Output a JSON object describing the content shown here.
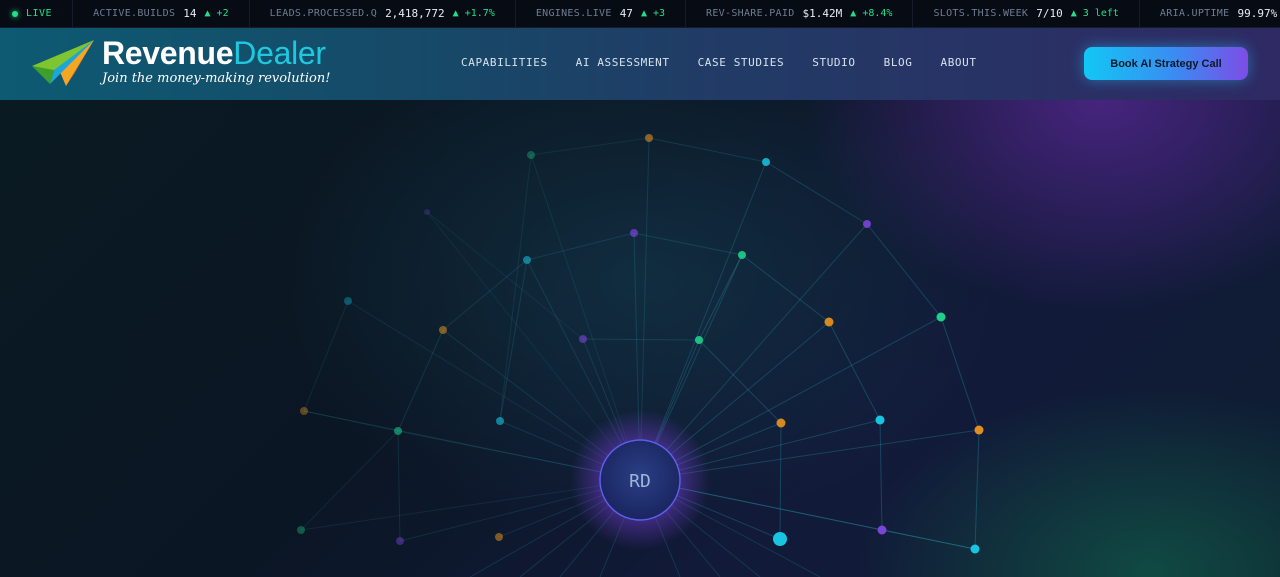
{
  "ticker": {
    "live_label": "LIVE",
    "items": [
      {
        "label": "ACTIVE.BUILDS",
        "value": "14",
        "delta": "▲ +2"
      },
      {
        "label": "LEADS.PROCESSED.Q",
        "value": "2,418,772",
        "delta": "▲ +1.7%"
      },
      {
        "label": "ENGINES.LIVE",
        "value": "47",
        "delta": "▲ +3"
      },
      {
        "label": "REV-SHARE.PAID",
        "value": "$1.42M",
        "delta": "▲ +8.4%"
      },
      {
        "label": "SLOTS.THIS.WEEK",
        "value": "7/10",
        "delta": "▲ 3 left"
      },
      {
        "label": "ARIA.UPTIME",
        "value": "99.97%",
        "delta": ""
      }
    ]
  },
  "brand": {
    "name_a": "Revenue",
    "name_b": "Dealer",
    "tagline": "Join the money-making revolution!"
  },
  "nav": {
    "items": [
      "CAPABILITIES",
      "AI ASSESSMENT",
      "CASE STUDIES",
      "STUDIO",
      "BLOG",
      "ABOUT"
    ]
  },
  "cta": {
    "label": "Book AI Strategy Call"
  },
  "hero": {
    "core_label": "RD"
  },
  "colors": {
    "green": "#22e08a",
    "cyan": "#1ec9e0",
    "purple": "#7c4de6",
    "orange": "#e0901e"
  }
}
